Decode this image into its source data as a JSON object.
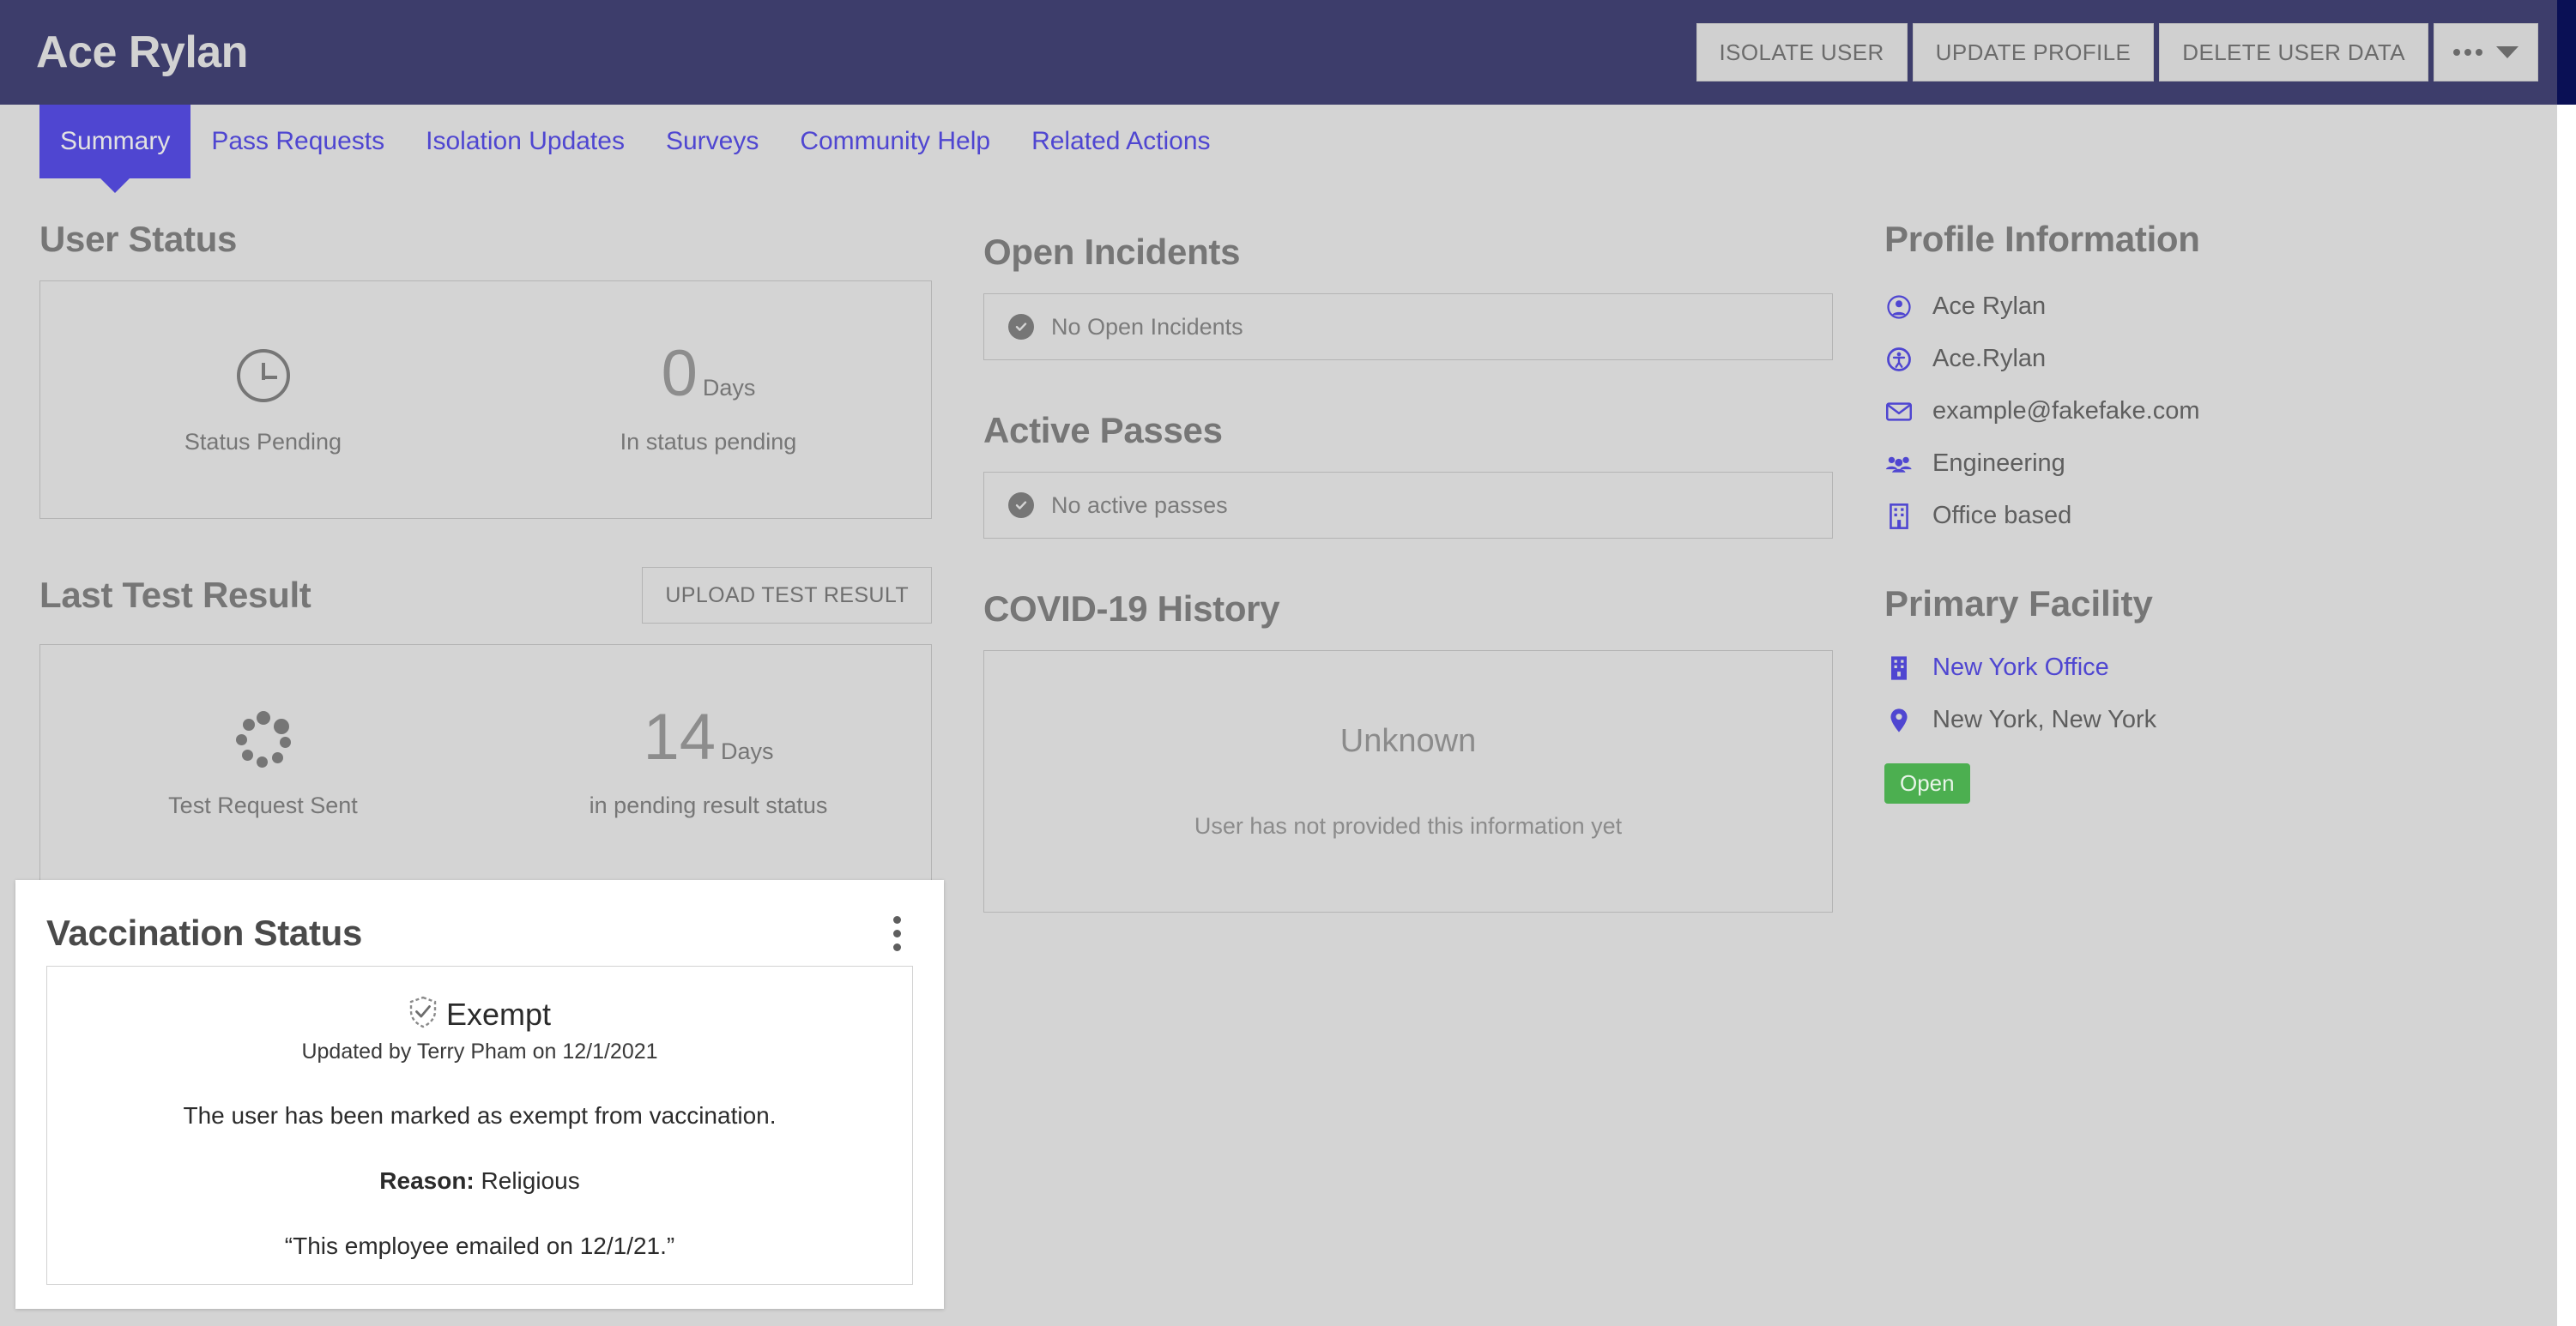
{
  "header": {
    "title": "Ace Rylan",
    "actions": [
      {
        "label": "ISOLATE USER",
        "name": "isolate-user-button"
      },
      {
        "label": "UPDATE PROFILE",
        "name": "update-profile-button"
      },
      {
        "label": "DELETE USER DATA",
        "name": "delete-user-data-button"
      }
    ],
    "more_menu": {
      "icon": "ellipsis-icon",
      "caret": "chevron-down-icon"
    }
  },
  "tabs": [
    {
      "label": "Summary",
      "active": true
    },
    {
      "label": "Pass Requests",
      "active": false
    },
    {
      "label": "Isolation Updates",
      "active": false
    },
    {
      "label": "Surveys",
      "active": false
    },
    {
      "label": "Community Help",
      "active": false
    },
    {
      "label": "Related Actions",
      "active": false
    }
  ],
  "user_status": {
    "title": "User Status",
    "status_icon": "clock-icon",
    "status_label": "Status Pending",
    "days_value": "0",
    "days_unit": "Days",
    "days_label": "In status pending"
  },
  "last_test_result": {
    "title": "Last Test Result",
    "upload_button": "UPLOAD TEST RESULT",
    "status_icon": "spinner-icon",
    "status_label": "Test Request Sent",
    "days_value": "14",
    "days_unit": "Days",
    "days_label": "in pending result status"
  },
  "vaccination": {
    "title": "Vaccination Status",
    "menu_icon": "kebab-menu-icon",
    "status_icon": "shield-check-dashed-icon",
    "status": "Exempt",
    "updated": "Updated by Terry Pham on 12/1/2021",
    "description": "The user has been marked as exempt from vaccination.",
    "reason_label": "Reason:",
    "reason_value": "Religious",
    "quote": "“This employee emailed on 12/1/21.”"
  },
  "open_incidents": {
    "title": "Open Incidents",
    "empty_icon": "check-circle-icon",
    "empty_text": "No Open Incidents"
  },
  "active_passes": {
    "title": "Active Passes",
    "empty_icon": "check-circle-icon",
    "empty_text": "No active passes"
  },
  "covid_history": {
    "title": "COVID-19 History",
    "main": "Unknown",
    "sub": "User has not provided this information yet"
  },
  "profile_information": {
    "title": "Profile Information",
    "rows": [
      {
        "icon": "user-icon",
        "text": "Ace Rylan",
        "link": false
      },
      {
        "icon": "user-circle-icon",
        "text": "Ace.Rylan",
        "link": false
      },
      {
        "icon": "envelope-icon",
        "text": "example@fakefake.com",
        "link": false
      },
      {
        "icon": "users-group-icon",
        "text": "Engineering",
        "link": false
      },
      {
        "icon": "building-icon",
        "text": "Office based",
        "link": false
      }
    ]
  },
  "primary_facility": {
    "title": "Primary Facility",
    "facility_icon": "building-icon",
    "facility_name": "New York Office",
    "location_icon": "map-pin-icon",
    "location": "New York, New York",
    "status_badge": "Open"
  },
  "colors": {
    "header_bg": "#3d3d6b",
    "accent_purple": "#4f46d1",
    "page_bg": "#d4d4d4",
    "badge_green": "#4caf50",
    "gutter_navy": "#0a1055"
  }
}
